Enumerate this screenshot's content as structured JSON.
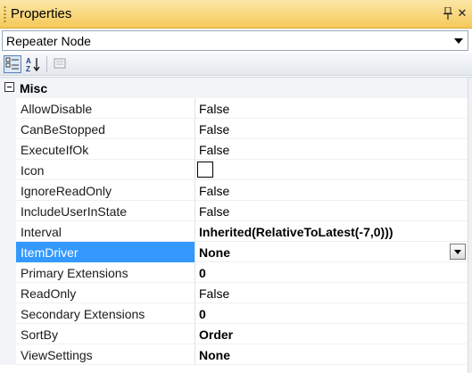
{
  "window": {
    "title": "Properties"
  },
  "selector": {
    "value": "Repeater Node"
  },
  "category": {
    "label": "Misc"
  },
  "properties": [
    {
      "name": "AllowDisable",
      "value": "False",
      "bold": false
    },
    {
      "name": "CanBeStopped",
      "value": "False",
      "bold": false
    },
    {
      "name": "ExecuteIfOk",
      "value": "False",
      "bold": false
    },
    {
      "name": "Icon",
      "value": "",
      "bold": false,
      "type": "icon"
    },
    {
      "name": "IgnoreReadOnly",
      "value": "False",
      "bold": false
    },
    {
      "name": "IncludeUserInState",
      "value": "False",
      "bold": false
    },
    {
      "name": "Interval",
      "value": "Inherited(RelativeToLatest(-7,0)))",
      "bold": true
    },
    {
      "name": "ItemDriver",
      "value": "None",
      "bold": true,
      "selected": true
    },
    {
      "name": "Primary Extensions",
      "value": "0",
      "bold": true
    },
    {
      "name": "ReadOnly",
      "value": "False",
      "bold": false
    },
    {
      "name": "Secondary Extensions",
      "value": "0",
      "bold": true
    },
    {
      "name": "SortBy",
      "value": "Order",
      "bold": true
    },
    {
      "name": "ViewSettings",
      "value": "None",
      "bold": true
    }
  ],
  "colors": {
    "title_bar": "#f5c95a",
    "selection": "#3399ff"
  }
}
